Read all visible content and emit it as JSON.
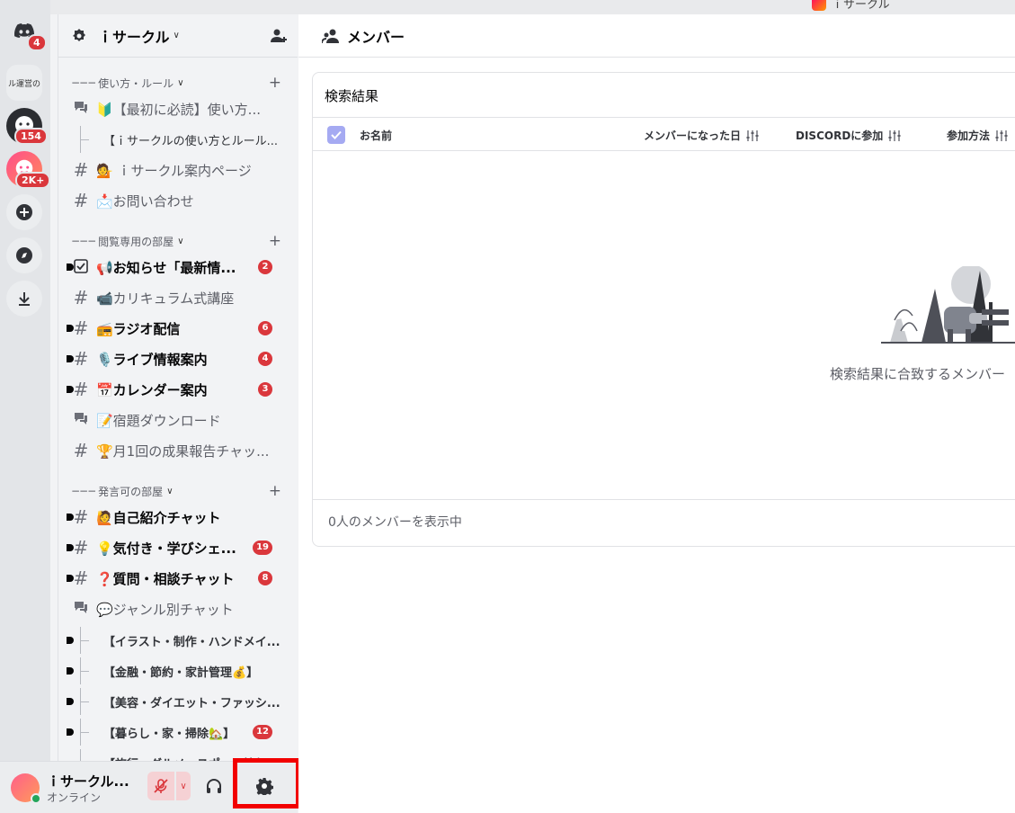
{
  "top_app": {
    "label": "ｉサークル"
  },
  "rail": {
    "home_badge": "4",
    "server_text": "ル運営の",
    "server2_badge": "154",
    "server3_badge": "2K+"
  },
  "guild": {
    "name": "ｉサークル"
  },
  "categories": [
    {
      "label": "使い方・ルール"
    },
    {
      "label": "閲覧専用の部屋"
    },
    {
      "label": "発言可の部屋"
    }
  ],
  "channels": [
    {
      "label": "🔰【最初に必読】使い方..."
    },
    {
      "label": "【ｉサークルの使い方とルール..."
    },
    {
      "label": "💁 ｉサークル案内ページ"
    },
    {
      "label": "📩お問い合わせ"
    },
    {
      "label": "📢お知らせ「最新情...",
      "badge": "2"
    },
    {
      "label": "📹カリキュラム式講座"
    },
    {
      "label": "📻ラジオ配信",
      "badge": "6"
    },
    {
      "label": "🎙️ライブ情報案内",
      "badge": "4"
    },
    {
      "label": "📅カレンダー案内",
      "badge": "3"
    },
    {
      "label": "📝宿題ダウンロード"
    },
    {
      "label": "🏆月1回の成果報告チャッ..."
    },
    {
      "label": "🙋自己紹介チャット"
    },
    {
      "label": "💡気付き・学びシェ...",
      "badge": "19"
    },
    {
      "label": "❓質問・相談チャット",
      "badge": "8"
    },
    {
      "label": "💬ジャンル別チャット"
    },
    {
      "label": "【イラスト・制作・ハンドメイ..."
    },
    {
      "label": "【金融・節約・家計管理💰】"
    },
    {
      "label": "【美容・ダイエット・ファッシ..."
    },
    {
      "label": "【暮らし・家・掃除🏡】",
      "badge": "12"
    },
    {
      "label": "【旅行・グルメ・スポット情報..."
    }
  ],
  "user": {
    "name": "ｉサークル...",
    "status": "オンライン"
  },
  "main": {
    "title": "メンバー",
    "panel_title": "検索結果",
    "columns": [
      "お名前",
      "メンバーになった日",
      "DISCORDに参加",
      "参加方法"
    ],
    "empty_text": "検索結果に合致するメンバー",
    "footer": "0人のメンバーを表示中"
  },
  "colors": {
    "badge": "#da373c",
    "highlight": "#f20000",
    "checkbox": "#a5aaf2",
    "online": "#23a55a"
  }
}
